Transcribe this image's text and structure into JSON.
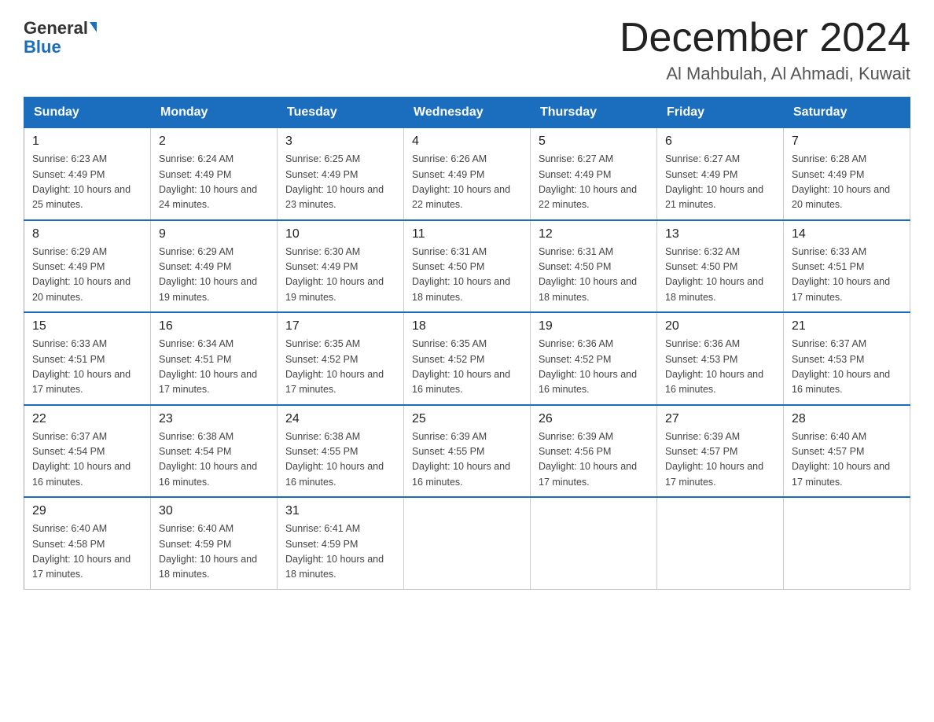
{
  "header": {
    "logo_general": "General",
    "logo_blue": "Blue",
    "month_title": "December 2024",
    "location": "Al Mahbulah, Al Ahmadi, Kuwait"
  },
  "weekdays": [
    "Sunday",
    "Monday",
    "Tuesday",
    "Wednesday",
    "Thursday",
    "Friday",
    "Saturday"
  ],
  "weeks": [
    [
      {
        "day": "1",
        "sunrise": "6:23 AM",
        "sunset": "4:49 PM",
        "daylight": "10 hours and 25 minutes."
      },
      {
        "day": "2",
        "sunrise": "6:24 AM",
        "sunset": "4:49 PM",
        "daylight": "10 hours and 24 minutes."
      },
      {
        "day": "3",
        "sunrise": "6:25 AM",
        "sunset": "4:49 PM",
        "daylight": "10 hours and 23 minutes."
      },
      {
        "day": "4",
        "sunrise": "6:26 AM",
        "sunset": "4:49 PM",
        "daylight": "10 hours and 22 minutes."
      },
      {
        "day": "5",
        "sunrise": "6:27 AM",
        "sunset": "4:49 PM",
        "daylight": "10 hours and 22 minutes."
      },
      {
        "day": "6",
        "sunrise": "6:27 AM",
        "sunset": "4:49 PM",
        "daylight": "10 hours and 21 minutes."
      },
      {
        "day": "7",
        "sunrise": "6:28 AM",
        "sunset": "4:49 PM",
        "daylight": "10 hours and 20 minutes."
      }
    ],
    [
      {
        "day": "8",
        "sunrise": "6:29 AM",
        "sunset": "4:49 PM",
        "daylight": "10 hours and 20 minutes."
      },
      {
        "day": "9",
        "sunrise": "6:29 AM",
        "sunset": "4:49 PM",
        "daylight": "10 hours and 19 minutes."
      },
      {
        "day": "10",
        "sunrise": "6:30 AM",
        "sunset": "4:49 PM",
        "daylight": "10 hours and 19 minutes."
      },
      {
        "day": "11",
        "sunrise": "6:31 AM",
        "sunset": "4:50 PM",
        "daylight": "10 hours and 18 minutes."
      },
      {
        "day": "12",
        "sunrise": "6:31 AM",
        "sunset": "4:50 PM",
        "daylight": "10 hours and 18 minutes."
      },
      {
        "day": "13",
        "sunrise": "6:32 AM",
        "sunset": "4:50 PM",
        "daylight": "10 hours and 18 minutes."
      },
      {
        "day": "14",
        "sunrise": "6:33 AM",
        "sunset": "4:51 PM",
        "daylight": "10 hours and 17 minutes."
      }
    ],
    [
      {
        "day": "15",
        "sunrise": "6:33 AM",
        "sunset": "4:51 PM",
        "daylight": "10 hours and 17 minutes."
      },
      {
        "day": "16",
        "sunrise": "6:34 AM",
        "sunset": "4:51 PM",
        "daylight": "10 hours and 17 minutes."
      },
      {
        "day": "17",
        "sunrise": "6:35 AM",
        "sunset": "4:52 PM",
        "daylight": "10 hours and 17 minutes."
      },
      {
        "day": "18",
        "sunrise": "6:35 AM",
        "sunset": "4:52 PM",
        "daylight": "10 hours and 16 minutes."
      },
      {
        "day": "19",
        "sunrise": "6:36 AM",
        "sunset": "4:52 PM",
        "daylight": "10 hours and 16 minutes."
      },
      {
        "day": "20",
        "sunrise": "6:36 AM",
        "sunset": "4:53 PM",
        "daylight": "10 hours and 16 minutes."
      },
      {
        "day": "21",
        "sunrise": "6:37 AM",
        "sunset": "4:53 PM",
        "daylight": "10 hours and 16 minutes."
      }
    ],
    [
      {
        "day": "22",
        "sunrise": "6:37 AM",
        "sunset": "4:54 PM",
        "daylight": "10 hours and 16 minutes."
      },
      {
        "day": "23",
        "sunrise": "6:38 AM",
        "sunset": "4:54 PM",
        "daylight": "10 hours and 16 minutes."
      },
      {
        "day": "24",
        "sunrise": "6:38 AM",
        "sunset": "4:55 PM",
        "daylight": "10 hours and 16 minutes."
      },
      {
        "day": "25",
        "sunrise": "6:39 AM",
        "sunset": "4:55 PM",
        "daylight": "10 hours and 16 minutes."
      },
      {
        "day": "26",
        "sunrise": "6:39 AM",
        "sunset": "4:56 PM",
        "daylight": "10 hours and 17 minutes."
      },
      {
        "day": "27",
        "sunrise": "6:39 AM",
        "sunset": "4:57 PM",
        "daylight": "10 hours and 17 minutes."
      },
      {
        "day": "28",
        "sunrise": "6:40 AM",
        "sunset": "4:57 PM",
        "daylight": "10 hours and 17 minutes."
      }
    ],
    [
      {
        "day": "29",
        "sunrise": "6:40 AM",
        "sunset": "4:58 PM",
        "daylight": "10 hours and 17 minutes."
      },
      {
        "day": "30",
        "sunrise": "6:40 AM",
        "sunset": "4:59 PM",
        "daylight": "10 hours and 18 minutes."
      },
      {
        "day": "31",
        "sunrise": "6:41 AM",
        "sunset": "4:59 PM",
        "daylight": "10 hours and 18 minutes."
      },
      null,
      null,
      null,
      null
    ]
  ]
}
